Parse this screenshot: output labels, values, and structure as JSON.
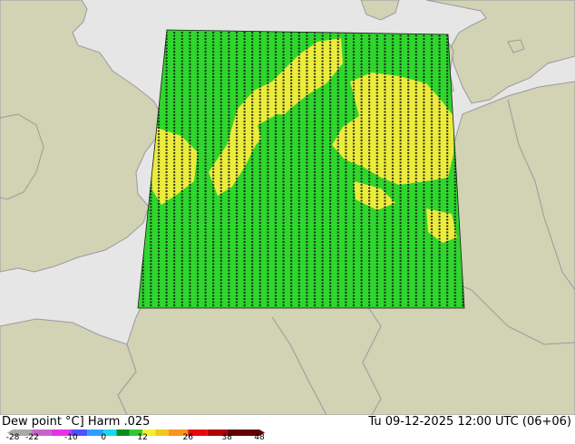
{
  "header": {
    "title": "Dew point °C] Harm .025",
    "datetime": "Tu 09-12-2025 12:00 UTC (06+06)"
  },
  "legend": {
    "ticks": [
      "-28",
      "-22",
      "-10",
      "0",
      "12",
      "26",
      "38",
      "48"
    ],
    "stops": [
      {
        "from": -28,
        "to": -22,
        "color": "#a8a8a8"
      },
      {
        "from": -22,
        "to": -16,
        "color": "#c864c8"
      },
      {
        "from": -16,
        "to": -10,
        "color": "#e632e6"
      },
      {
        "from": -10,
        "to": -5,
        "color": "#5050ff"
      },
      {
        "from": -5,
        "to": 0,
        "color": "#2ca0ff"
      },
      {
        "from": 0,
        "to": 4,
        "color": "#14dcf0"
      },
      {
        "from": 4,
        "to": 8,
        "color": "#0a8c1e"
      },
      {
        "from": 8,
        "to": 12,
        "color": "#32c832"
      },
      {
        "from": 12,
        "to": 16,
        "color": "#f0f032"
      },
      {
        "from": 16,
        "to": 20,
        "color": "#f0c81e"
      },
      {
        "from": 20,
        "to": 26,
        "color": "#f5961e"
      },
      {
        "from": 26,
        "to": 32,
        "color": "#e60a0a"
      },
      {
        "from": 32,
        "to": 38,
        "color": "#b40000"
      },
      {
        "from": 38,
        "to": 48,
        "color": "#640000"
      }
    ]
  },
  "map": {
    "sea_color": "#e6e6e6",
    "land_color": "#d2d2b4",
    "border_color": "#9a9aa0",
    "field_green": "#2ed62e",
    "field_yellow": "#ecec3c"
  }
}
